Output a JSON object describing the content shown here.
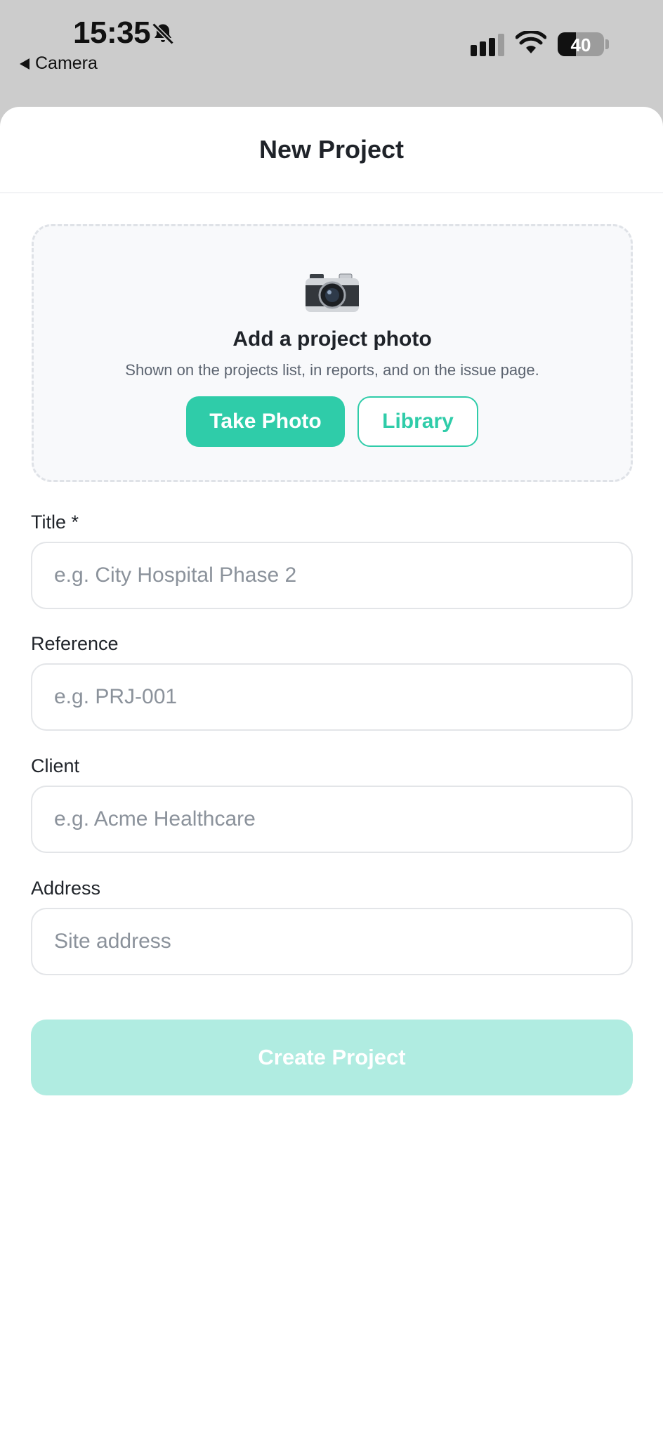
{
  "status_bar": {
    "time": "15:35",
    "back_label": "Camera",
    "battery_level": "40",
    "icons": [
      "bell-slash-icon",
      "cellular-signal-icon",
      "wifi-icon",
      "battery-icon"
    ]
  },
  "sheet": {
    "title": "New Project"
  },
  "photo_card": {
    "icon": "camera-icon",
    "title": "Add a project photo",
    "subtitle": "Shown on the projects list, in reports, and on the issue page.",
    "take_photo_label": "Take Photo",
    "library_label": "Library"
  },
  "form": {
    "title": {
      "label": "Title *",
      "value": "",
      "placeholder": "e.g. City Hospital Phase 2"
    },
    "reference": {
      "label": "Reference",
      "value": "",
      "placeholder": "e.g. PRJ-001"
    },
    "client": {
      "label": "Client",
      "value": "",
      "placeholder": "e.g. Acme Healthcare"
    },
    "address": {
      "label": "Address",
      "value": "",
      "placeholder": "Site address"
    }
  },
  "create_button_label": "Create Project",
  "colors": {
    "accent": "#2fcca9",
    "accent_disabled": "#b0ece1",
    "status_bar_bg": "#cccccc",
    "text_primary": "#1f2329",
    "text_secondary": "#5c6470"
  }
}
